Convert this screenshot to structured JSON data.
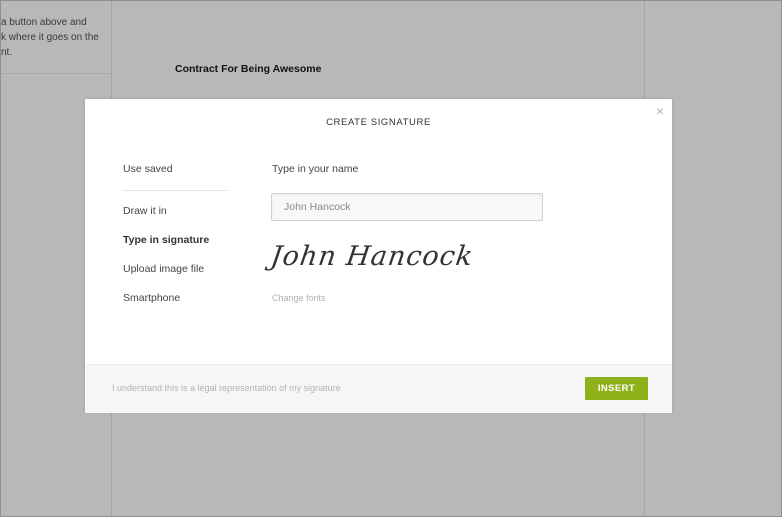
{
  "background": {
    "help_text": "a button above and\nk where it goes on the\nnt.",
    "document_title": "Contract For Being Awesome"
  },
  "modal": {
    "title": "CREATE SIGNATURE",
    "close_glyph": "×",
    "nav": {
      "use_saved": "Use saved",
      "draw_it_in": "Draw it in",
      "type_in_signature": "Type in signature",
      "upload_image_file": "Upload image file",
      "smartphone": "Smartphone"
    },
    "name_field": {
      "label": "Type in your name",
      "value": "John Hancock",
      "placeholder": ""
    },
    "signature_preview": "John Hancock",
    "change_fonts": "Change fonts",
    "legal_text": "I understand this is a legal representation of my signature",
    "insert_label": "INSERT"
  },
  "colors": {
    "accent": "#8fb21a",
    "overlay": "#b8b8b8"
  }
}
